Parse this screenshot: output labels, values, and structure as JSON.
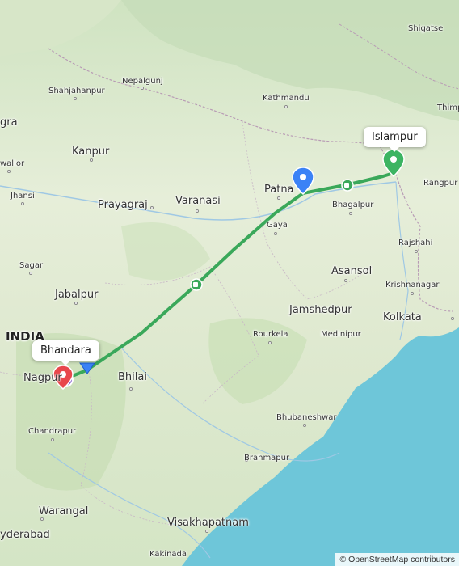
{
  "map": {
    "country_label": "INDIA",
    "cities": [
      {
        "name": "Shigatse",
        "size": "town"
      },
      {
        "name": "Nepalgunj",
        "size": "town"
      },
      {
        "name": "Shahjahanpur",
        "size": "town"
      },
      {
        "name": "Kathmandu",
        "size": "town"
      },
      {
        "name": "Thimp",
        "size": "town"
      },
      {
        "name": "Kanpur",
        "size": "city"
      },
      {
        "name": "Prayagraj",
        "size": "city"
      },
      {
        "name": "Varanasi",
        "size": "city"
      },
      {
        "name": "Patna",
        "size": "city"
      },
      {
        "name": "Bhagalpur",
        "size": "town"
      },
      {
        "name": "Rangpur",
        "size": "town"
      },
      {
        "name": "Gaya",
        "size": "town"
      },
      {
        "name": "Rajshahi",
        "size": "town"
      },
      {
        "name": "Asansol",
        "size": "city"
      },
      {
        "name": "Krishnanagar",
        "size": "town"
      },
      {
        "name": "Jabalpur",
        "size": "city"
      },
      {
        "name": "Jamshedpur",
        "size": "city"
      },
      {
        "name": "Kolkata",
        "size": "city"
      },
      {
        "name": "Rourkela",
        "size": "town"
      },
      {
        "name": "Medinipur",
        "size": "town"
      },
      {
        "name": "Nagpur",
        "size": "city"
      },
      {
        "name": "Bhilai",
        "size": "city"
      },
      {
        "name": "Bhubaneshwar",
        "size": "town"
      },
      {
        "name": "Chandrapur",
        "size": "town"
      },
      {
        "name": "Brahmapur",
        "size": "town"
      },
      {
        "name": "Warangal",
        "size": "city"
      },
      {
        "name": "Visakhapatnam",
        "size": "city"
      },
      {
        "name": "yderabad",
        "size": "city"
      },
      {
        "name": "Kakinada",
        "size": "town"
      },
      {
        "name": "gra",
        "size": "city"
      },
      {
        "name": "walior",
        "size": "town"
      },
      {
        "name": "Jhansi",
        "size": "town"
      },
      {
        "name": "Sagar",
        "size": "town"
      }
    ],
    "markers": {
      "start": {
        "label": "Islampur",
        "color": "#3cb462"
      },
      "end": {
        "label": "Bhandara",
        "color": "#e8474c"
      },
      "waypoint": {
        "color": "#3b82f6"
      }
    },
    "route_color": "#3aa85a",
    "attribution": "© OpenStreetMap contributors"
  }
}
